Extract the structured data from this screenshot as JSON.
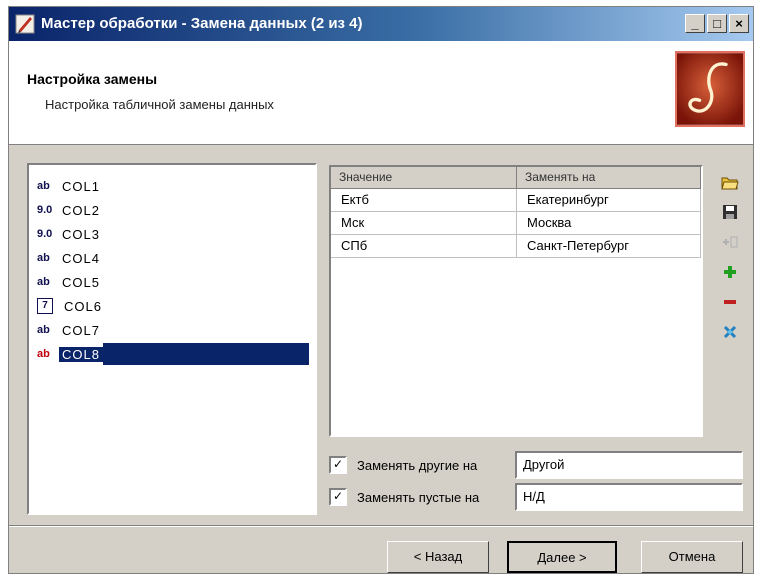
{
  "window": {
    "title": "Мастер обработки - Замена данных (2 из 4)",
    "buttons": {
      "minimize": "_",
      "maximize": "□",
      "close": "×"
    }
  },
  "header": {
    "title": "Настройка замены",
    "subtitle": "Настройка табличной замены данных",
    "logo_icon": "swirl-logo"
  },
  "fields": [
    {
      "type_badge": "ab",
      "name": "COL1",
      "icon": "string-type-icon"
    },
    {
      "type_badge": "9.0",
      "name": "COL2",
      "icon": "number-type-icon"
    },
    {
      "type_badge": "9.0",
      "name": "COL3",
      "icon": "number-type-icon"
    },
    {
      "type_badge": "ab",
      "name": "COL4",
      "icon": "string-type-icon"
    },
    {
      "type_badge": "ab",
      "name": "COL5",
      "icon": "string-type-icon"
    },
    {
      "type_badge": "7",
      "name": "COL6",
      "icon": "date-type-icon"
    },
    {
      "type_badge": "ab",
      "name": "COL7",
      "icon": "string-type-icon"
    },
    {
      "type_badge": "ab",
      "name": "COL8",
      "icon": "string-type-icon",
      "selected": true
    }
  ],
  "replace_table": {
    "columns": [
      "Значение",
      "Заменять на"
    ],
    "rows": [
      [
        "Ектб",
        "Екатеринбург"
      ],
      [
        "Мск",
        "Москва"
      ],
      [
        "СПб",
        "Санкт-Петербург"
      ]
    ]
  },
  "toolbar_icons": [
    "open-folder-icon",
    "save-icon",
    "insert-icon",
    "add-icon",
    "remove-icon",
    "clear-icon"
  ],
  "options": {
    "replace_other": {
      "checked": "✓",
      "label": "Заменять другие на",
      "value": "Другой"
    },
    "replace_empty": {
      "checked": "✓",
      "label": "Заменять пустые на",
      "value": "Н/Д"
    }
  },
  "footer": {
    "back_label": "< Назад",
    "next_label": "Далее >",
    "cancel_label": "Отмена"
  },
  "colors": {
    "title_start": "#0a246a",
    "title_end": "#a6caf0",
    "selection": "#0a246a",
    "face": "#d4d0c8"
  }
}
